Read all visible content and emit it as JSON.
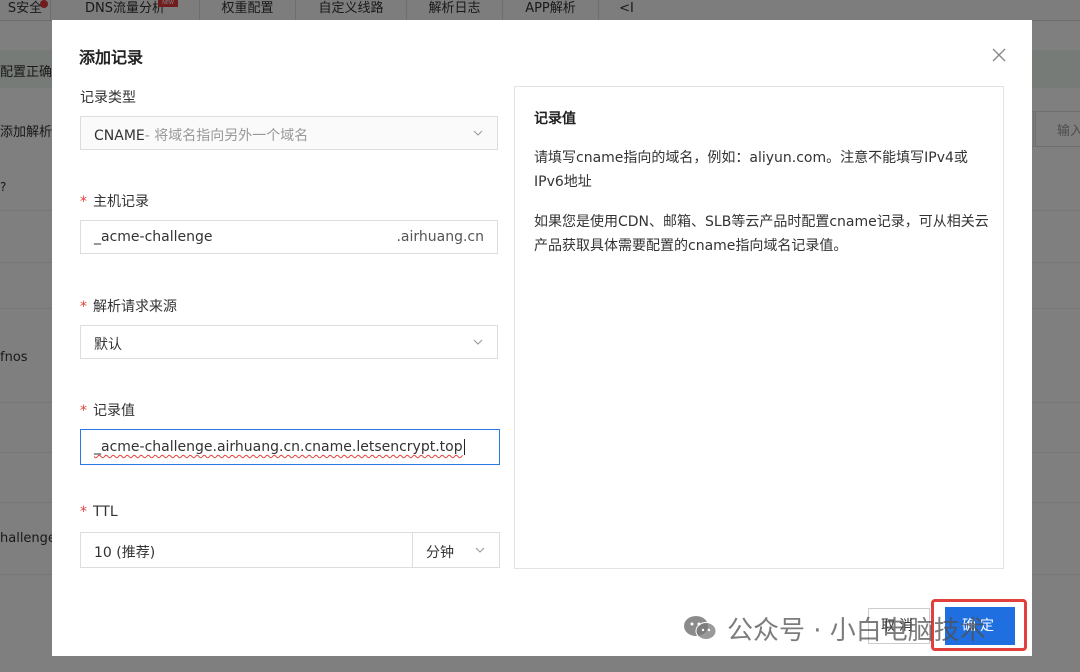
{
  "background": {
    "tabs": [
      {
        "label": "S安全"
      },
      {
        "label": "DNS流量分析"
      },
      {
        "label": "权重配置"
      },
      {
        "label": "自定义线路"
      },
      {
        "label": "解析日志"
      },
      {
        "label": "APP解析"
      },
      {
        "label": "<I"
      }
    ],
    "banner_text": "配置正确",
    "add_record_text": "添加解析",
    "search_placeholder": "输入",
    "row_texts": [
      "fnos",
      "hallenge"
    ]
  },
  "modal": {
    "title": "添加记录",
    "record_type": {
      "label": "记录类型",
      "value": "CNAME",
      "value_desc": "- 将域名指向另外一个域名"
    },
    "host": {
      "label": "主机记录",
      "value": "_acme-challenge",
      "suffix": ".airhuang.cn"
    },
    "line": {
      "label": "解析请求来源",
      "value": "默认"
    },
    "record_value": {
      "label": "记录值",
      "value": "_acme-challenge.airhuang.cn.cname.letsencrypt.top"
    },
    "ttl": {
      "label": "TTL",
      "value": "10 (推荐)",
      "unit": "分钟"
    },
    "help": {
      "title": "记录值",
      "p1": "请填写cname指向的域名，例如：aliyun.com。注意不能填写IPv4或IPv6地址",
      "p2": "如果您是使用CDN、邮箱、SLB等云产品时配置cname记录，可从相关云产品获取具体需要配置的cname指向域名记录值。"
    },
    "buttons": {
      "cancel": "取消",
      "ok": "确定"
    }
  },
  "watermark": {
    "text": "公众号 · 小白电脑技术"
  },
  "colors": {
    "primary": "#1f6fe0",
    "required": "#e2403c",
    "highlight": "#e2403c"
  }
}
